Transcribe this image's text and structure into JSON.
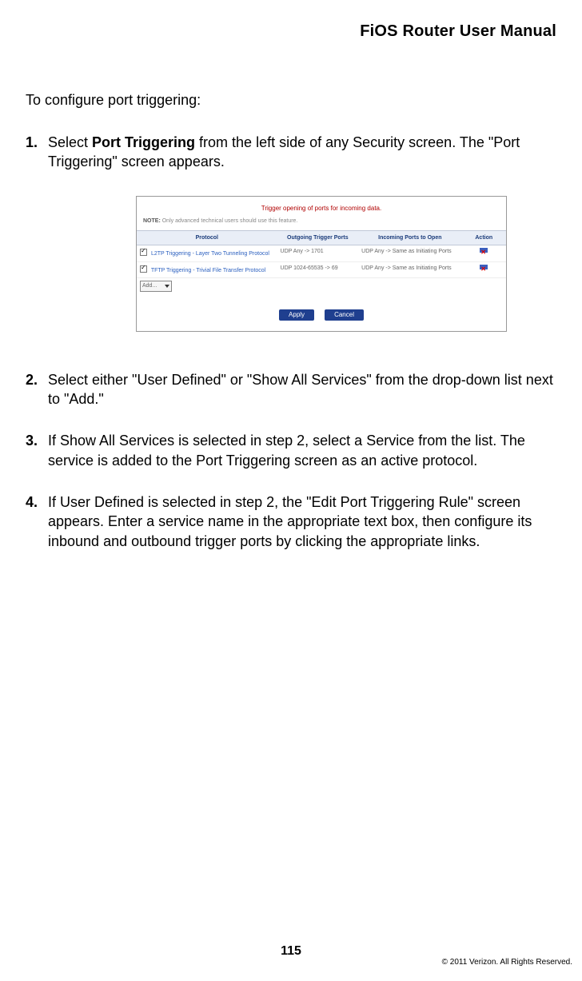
{
  "header": {
    "title": "FiOS Router User Manual"
  },
  "intro": "To configure port triggering:",
  "steps": [
    {
      "pre": "Select ",
      "bold": "Port Triggering",
      "post": " from the left side of any Security screen. The \"Port Triggering\" screen appears."
    },
    {
      "text": "Select either \"User Defined\" or \"Show All Services\" from the drop-down list next to \"Add.\""
    },
    {
      "text": "If Show All Services is selected in step 2, select a Service from the list. The service is added to the Port Triggering screen as an active protocol."
    },
    {
      "text": "If User Defined is selected in step 2, the \"Edit Port Triggering Rule\" screen appears. Enter a service name in the appropriate text box, then configure its inbound and outbound trigger ports by clicking the appropriate links."
    }
  ],
  "figure": {
    "caption": "Trigger opening of ports for incoming data.",
    "note_label": "NOTE:",
    "note_text": "Only advanced technical users should use this feature.",
    "headers": [
      "Protocol",
      "Outgoing Trigger Ports",
      "Incoming Ports to Open",
      "Action"
    ],
    "rows": [
      {
        "protocol": "L2TP Triggering - Layer Two Tunneling Protocol",
        "outgoing": "UDP Any -> 1701",
        "incoming": "UDP Any -> Same as Initiating Ports"
      },
      {
        "protocol": "TFTP Triggering - Trivial File Transfer Protocol",
        "outgoing": "UDP 1024-65535 -> 69",
        "incoming": "UDP Any -> Same as Initiating Ports"
      }
    ],
    "add_label": "Add...",
    "buttons": {
      "apply": "Apply",
      "cancel": "Cancel"
    }
  },
  "page_number": "115",
  "copyright": "© 2011 Verizon. All Rights Reserved."
}
